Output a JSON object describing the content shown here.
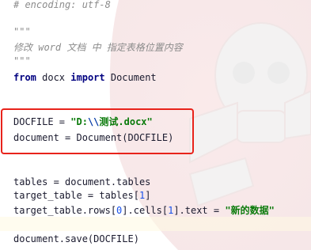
{
  "editor": {
    "lines": {
      "encoding": "# encoding: utf-8",
      "doc_open": "\"\"\"",
      "doc_text": "修改 word 文档 中 指定表格位置内容",
      "doc_close": "\"\"\"",
      "import_from": "from",
      "import_module": " docx ",
      "import_kw": "import",
      "import_name": " Document",
      "docfile_lhs": "DOCFILE = ",
      "docfile_str_open": "\"D:",
      "docfile_str_esc": "\\\\",
      "docfile_str_rest": "测试.docx\"",
      "document_assign": "document = Document(DOCFILE)",
      "tables_assign": "tables = document.tables",
      "target_lhs": "target_table = tables[",
      "target_idx": "1",
      "target_rhs": "]",
      "rows_a": "target_table.rows[",
      "rows_idx": "0",
      "rows_b": "].cells[",
      "cells_idx": "1",
      "rows_c": "].text = ",
      "rows_str": "\"新的数据\"",
      "save": "document.save(DOCFILE)"
    },
    "highlight_color": "#e8231b"
  }
}
